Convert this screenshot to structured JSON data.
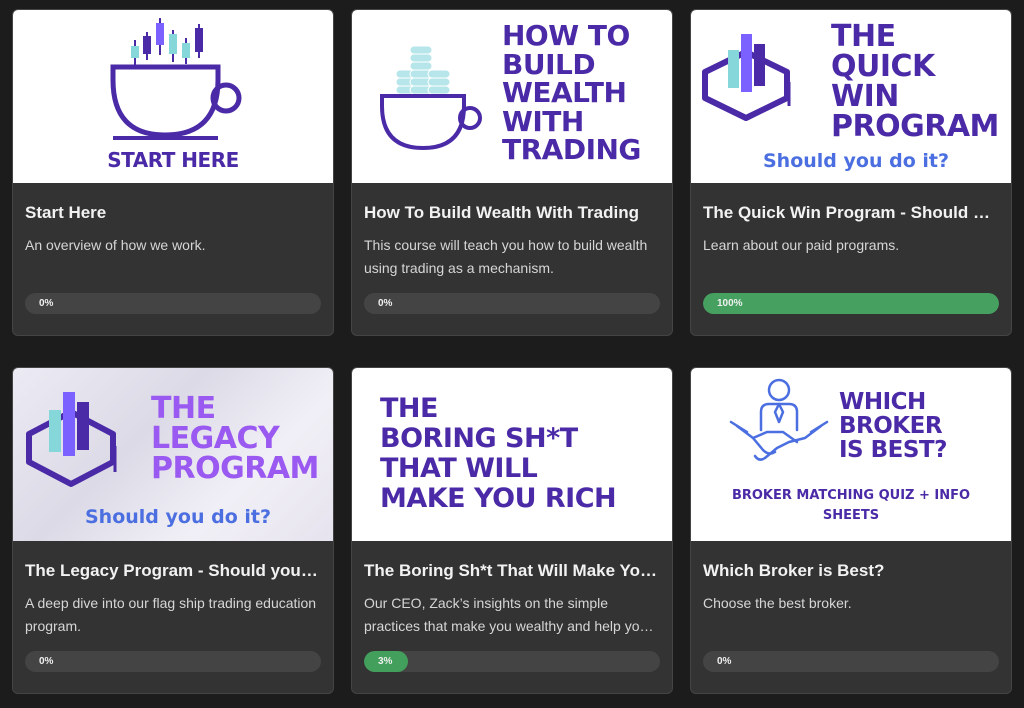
{
  "colors": {
    "background": "#1c1c1c",
    "card": "#333333",
    "track": "#444444",
    "progress_complete": "#46a160",
    "progress_partial": "#43a05c",
    "brand_purple": "#4a2aa6",
    "brand_violet": "#7b61ff",
    "brand_teal": "#86d7da",
    "subtitle_blue": "#4b6fe0",
    "legacy_purple": "#9a59f0"
  },
  "courses": [
    {
      "title": "Start Here",
      "description": "An overview of how we work.",
      "progress_label": "0%",
      "progress": 0,
      "thumbnail": {
        "icon": "coffee-cup-candlestick-icon",
        "caption": "START HERE"
      }
    },
    {
      "title": "How To Build Wealth With Trading",
      "description": "This course will teach you how to build wealth using trading as a mechanism.",
      "progress_label": "0%",
      "progress": 0,
      "thumbnail": {
        "icon": "coffee-cup-coins-icon",
        "lines": [
          "HOW TO",
          "BUILD",
          "WEALTH",
          "WITH",
          "TRADING"
        ]
      }
    },
    {
      "title": "The Quick Win Program - Should you do it?",
      "description": "Learn about our paid programs.",
      "progress_label": "100%",
      "progress": 100,
      "thumbnail": {
        "icon": "graduation-cap-chart-icon",
        "lines": [
          "THE",
          "QUICK",
          "WIN",
          "PROGRAM"
        ],
        "subtitle": "Should you do it?"
      }
    },
    {
      "title": "The Legacy Program - Should you do it?",
      "description": "A deep dive into our flag ship trading education program.",
      "progress_label": "0%",
      "progress": 0,
      "thumbnail": {
        "icon": "graduation-cap-chart-icon",
        "lines": [
          "THE",
          "LEGACY",
          "PROGRAM"
        ],
        "subtitle": "Should you do it?"
      }
    },
    {
      "title": "The Boring Sh*t That Will Make You Rich",
      "description": "Our CEO, Zack’s insights on the simple practices that make you wealthy and help you stay that way.",
      "progress_label": "3%",
      "progress": 3,
      "thumbnail": {
        "lines": [
          "THE",
          "BORING SH*T",
          "THAT WILL",
          "MAKE YOU RICH"
        ]
      }
    },
    {
      "title": "Which Broker is Best?",
      "description": "Choose the best broker.",
      "progress_label": "0%",
      "progress": 0,
      "thumbnail": {
        "icon": "handshake-person-icon",
        "lines": [
          "WHICH",
          "BROKER",
          "IS BEST?"
        ],
        "caption_lines": [
          "BROKER MATCHING QUIZ + INFO",
          "SHEETS"
        ]
      }
    }
  ]
}
